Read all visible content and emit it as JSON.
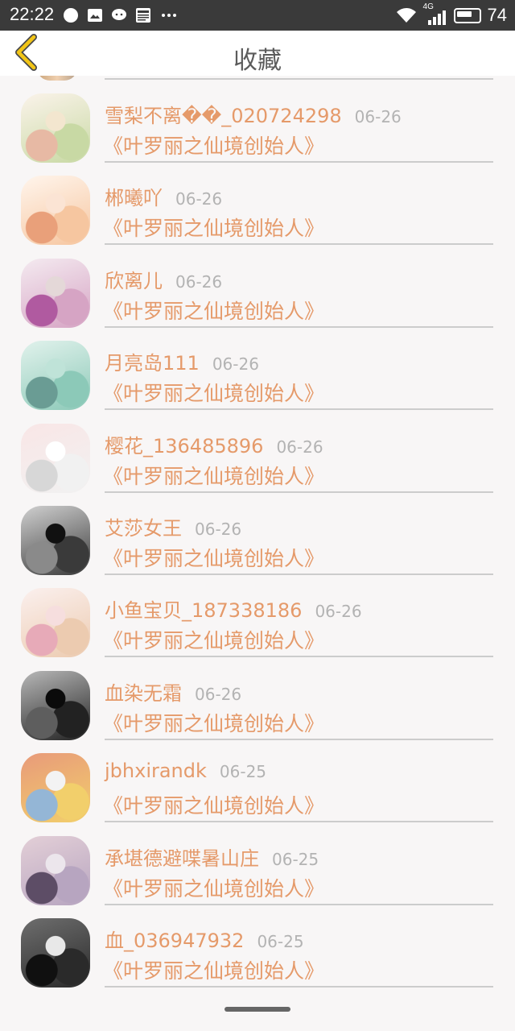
{
  "status_bar": {
    "time": "22:22",
    "network": "4G",
    "battery": "74"
  },
  "header": {
    "title": "收藏"
  },
  "items": [
    {
      "name": "雪梨不离��_020724298",
      "date": "06-26",
      "book": "《叶罗丽之仙境创始人》",
      "colors": [
        "#f3e6cf",
        "#c8d9a4",
        "#e7b9a4",
        "#fbf3ea"
      ]
    },
    {
      "name": "郴曦吖",
      "date": "06-26",
      "book": "《叶罗丽之仙境创始人》",
      "colors": [
        "#fbe4d4",
        "#f6c6a0",
        "#e9a07a",
        "#fff5ec"
      ]
    },
    {
      "name": "欣离儿",
      "date": "06-26",
      "book": "《叶罗丽之仙境创始人》",
      "colors": [
        "#e4d8d8",
        "#d6a4c4",
        "#b05aa0",
        "#f4eaf0"
      ]
    },
    {
      "name": "月亮岛111",
      "date": "06-26",
      "book": "《叶罗丽之仙境创始人》",
      "colors": [
        "#bfe3d8",
        "#8cc9b8",
        "#6a9c94",
        "#e1f2ec"
      ]
    },
    {
      "name": "樱花_136485896",
      "date": "06-26",
      "book": "《叶罗丽之仙境创始人》",
      "colors": [
        "#ffffff",
        "#f1f1f1",
        "#d7d7d7",
        "#f9e6e6"
      ]
    },
    {
      "name": "艾莎女王",
      "date": "06-26",
      "book": "《叶罗丽之仙境创始人》",
      "colors": [
        "#111111",
        "#3a3a3a",
        "#8a8a8a",
        "#d0d0d0"
      ]
    },
    {
      "name": "小鱼宝贝_187338186",
      "date": "06-26",
      "book": "《叶罗丽之仙境创始人》",
      "colors": [
        "#f6dede",
        "#eccbb0",
        "#e7aab8",
        "#fbf0ee"
      ]
    },
    {
      "name": "血染无霜",
      "date": "06-26",
      "book": "《叶罗丽之仙境创始人》",
      "colors": [
        "#0b0b0b",
        "#222222",
        "#5e5e5e",
        "#b8b8b8"
      ]
    },
    {
      "name": "jbhxirandk",
      "date": "06-25",
      "book": "《叶罗丽之仙境创始人》",
      "colors": [
        "#f3f3f3",
        "#f2cf6b",
        "#94b6d6",
        "#e89a7a"
      ]
    },
    {
      "name": "承堪德避喋暑山庄",
      "date": "06-25",
      "book": "《叶罗丽之仙境创始人》",
      "colors": [
        "#ece6ec",
        "#b7a5c0",
        "#5d4d66",
        "#e3cfd7"
      ]
    },
    {
      "name": "血_036947932",
      "date": "06-25",
      "book": "《叶罗丽之仙境创始人》",
      "colors": [
        "#e8e8e8",
        "#2a2a2a",
        "#101010",
        "#6e6e6e"
      ]
    }
  ]
}
